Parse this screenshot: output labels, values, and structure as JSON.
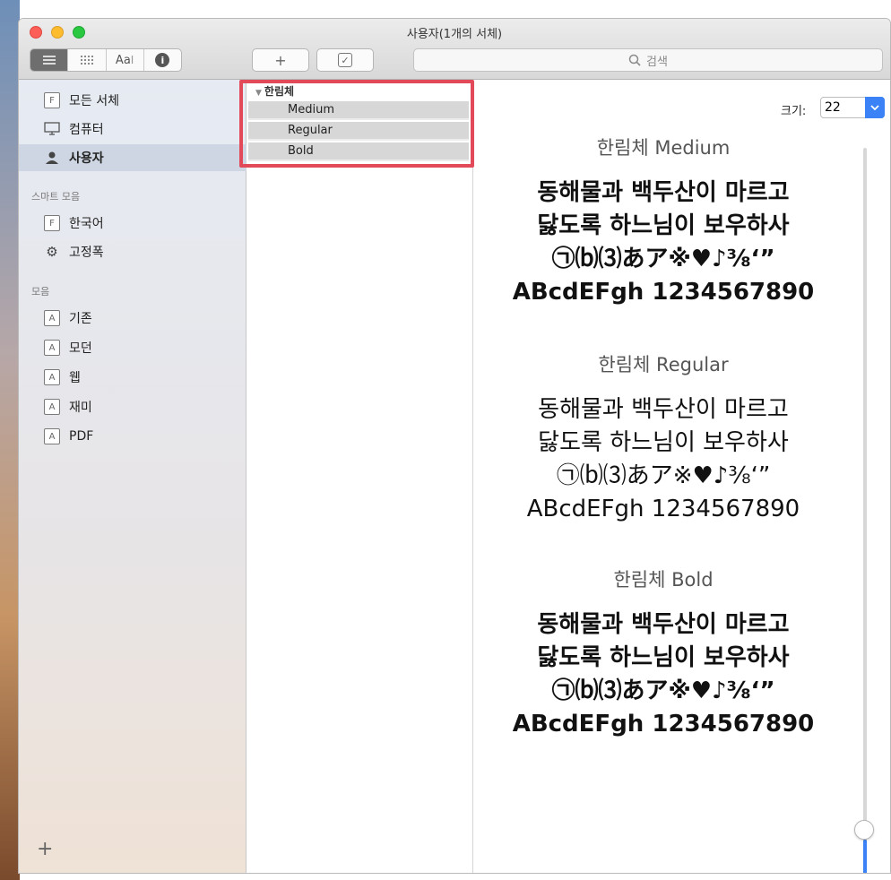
{
  "window": {
    "title": "사용자(1개의 서체)"
  },
  "toolbar": {
    "view_text_sample": "Aa",
    "view_text_cursor": "I",
    "info_glyph": "i",
    "add_label": "+",
    "validate_label": "✓",
    "search_placeholder": "검색"
  },
  "sidebar": {
    "items": [
      {
        "label": "모든 서체",
        "icon": "F"
      },
      {
        "label": "컴퓨터"
      },
      {
        "label": "사용자"
      }
    ],
    "smart_header": "스마트 모음",
    "smart_items": [
      {
        "label": "한국어",
        "icon": "F"
      },
      {
        "label": "고정폭"
      }
    ],
    "collection_header": "모음",
    "collections": [
      {
        "label": "기존",
        "icon": "A"
      },
      {
        "label": "모던",
        "icon": "A"
      },
      {
        "label": "웹",
        "icon": "A"
      },
      {
        "label": "재미",
        "icon": "A"
      },
      {
        "label": "PDF",
        "icon": "A"
      }
    ],
    "add_label": "+"
  },
  "families": {
    "group": "한림체",
    "styles": [
      "Medium",
      "Regular",
      "Bold"
    ]
  },
  "preview": {
    "size_label": "크기:",
    "size_value": "22",
    "samples": [
      {
        "name": "한림체 Medium",
        "lines": [
          "동해물과 백두산이 마르고",
          "닳도록 하느님이 보우하사",
          "㉠⒝⑶あア※♥♪⅜‘”",
          "ABcdEFgh 1234567890"
        ]
      },
      {
        "name": "한림체 Regular",
        "lines": [
          "동해물과 백두산이 마르고",
          "닳도록 하느님이 보우하사",
          "㉠⒝⑶あア※♥♪⅜‘”",
          "ABcdEFgh 1234567890"
        ]
      },
      {
        "name": "한림체 Bold",
        "lines": [
          "동해물과 백두산이 마르고",
          "닳도록 하느님이 보우하사",
          "㉠⒝⑶あア※♥♪⅜‘”",
          "ABcdEFgh 1234567890"
        ]
      }
    ]
  },
  "colors": {
    "accent": "#3b82f6",
    "highlight_box": "#e24a5a",
    "selection": "#cdd6e2"
  }
}
